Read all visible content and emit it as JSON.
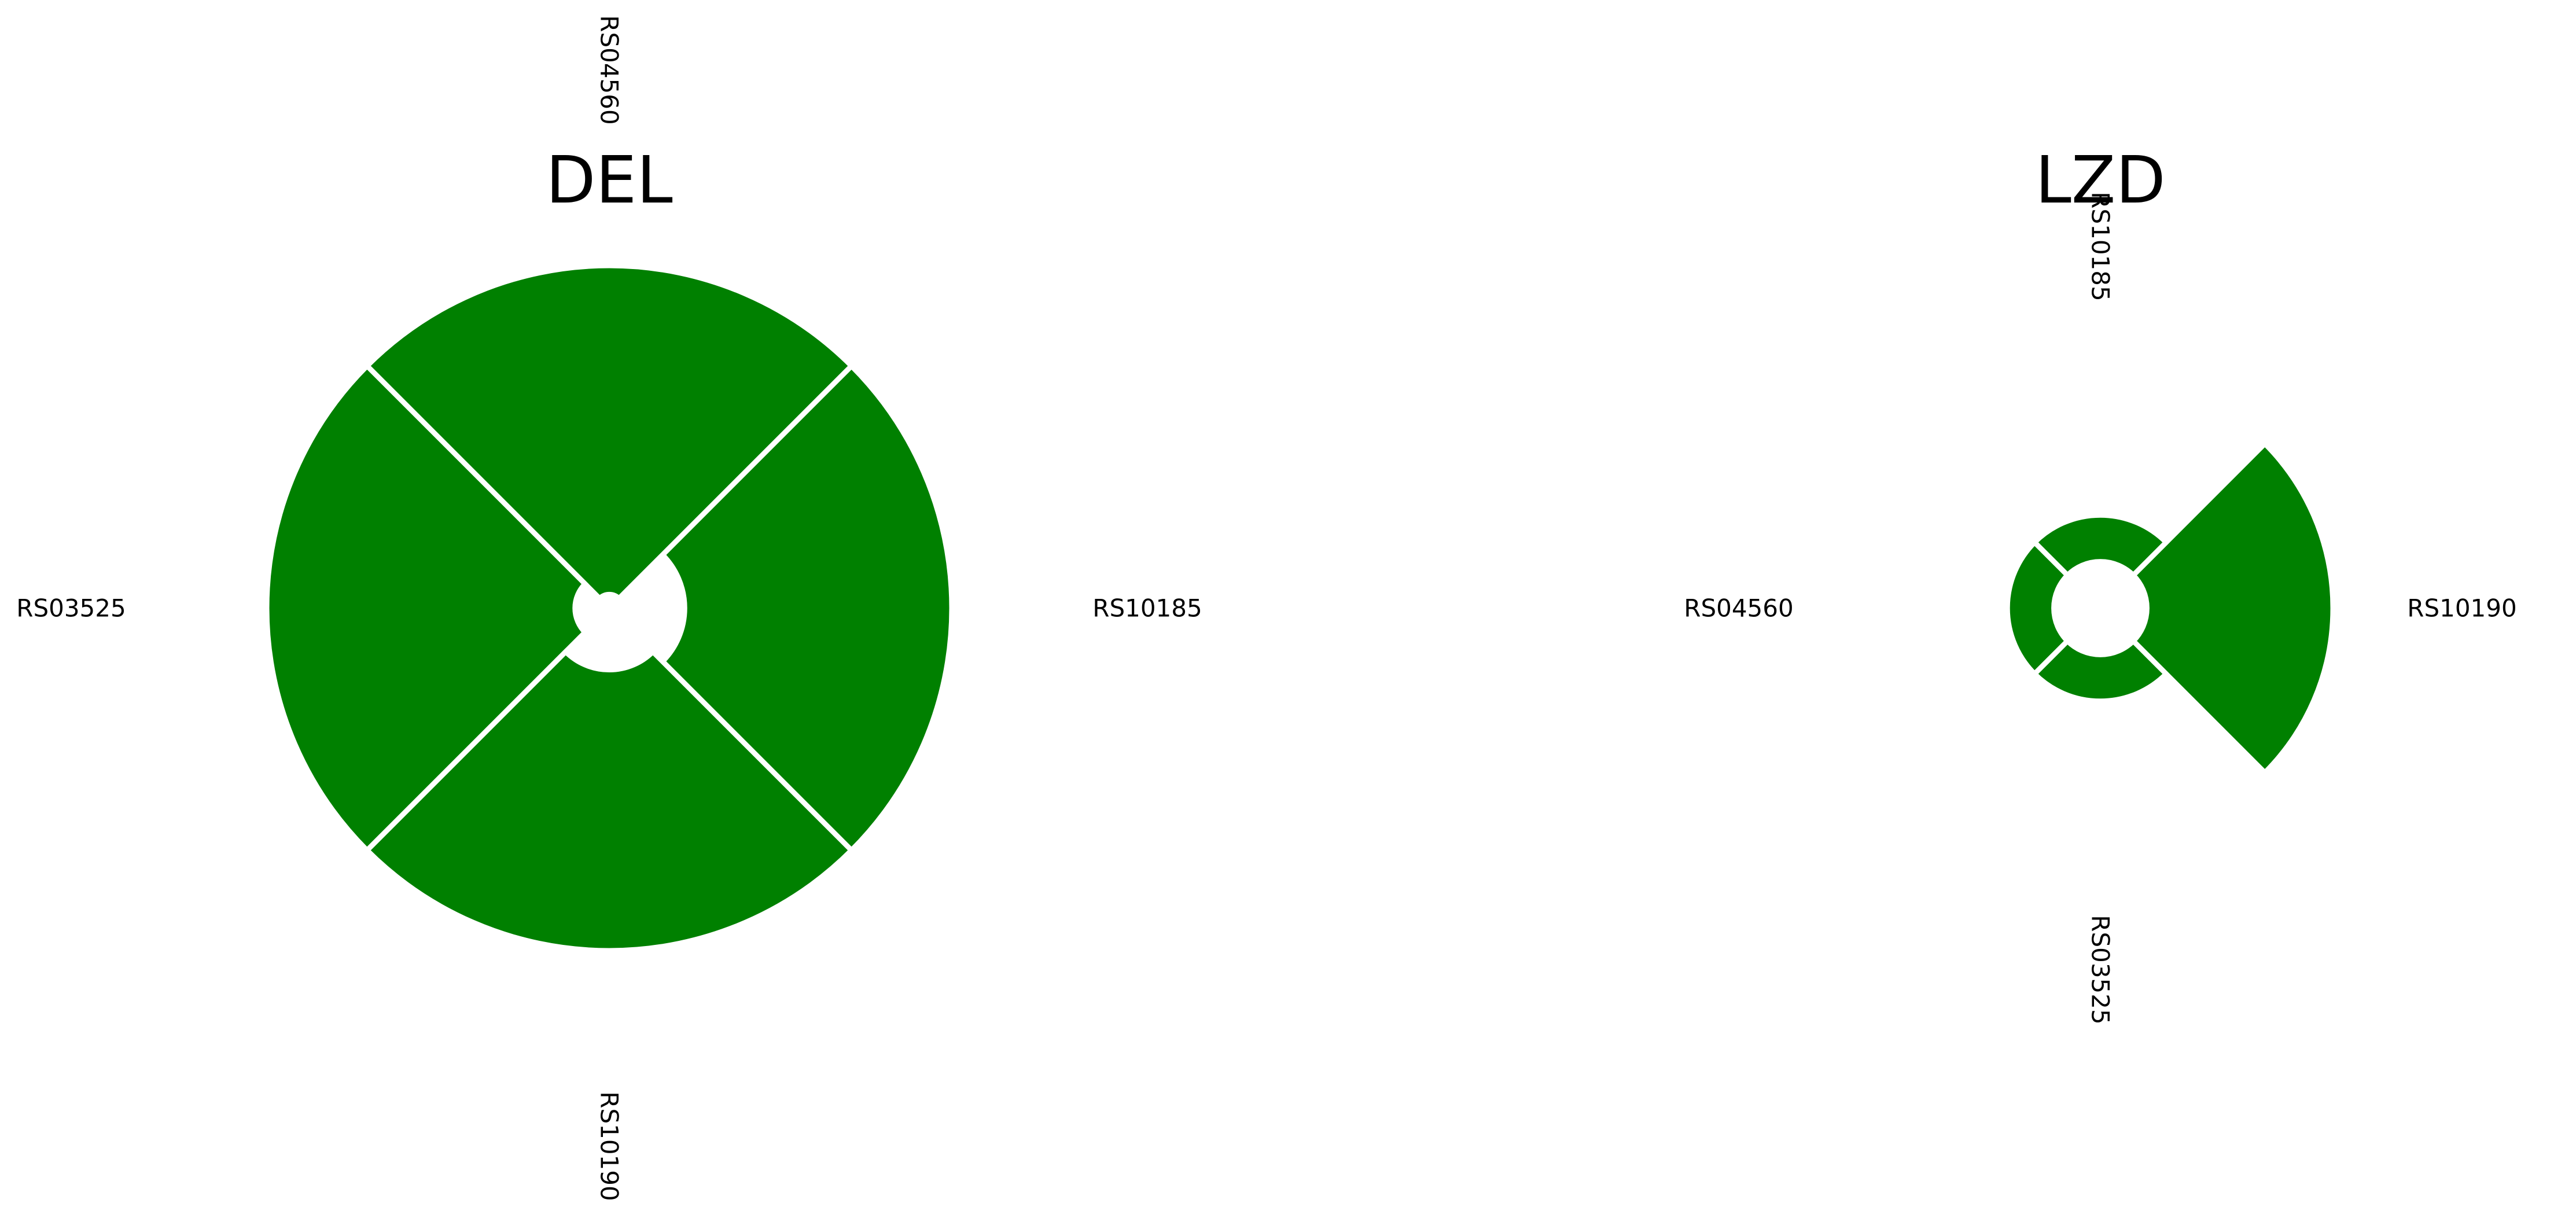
{
  "chart_data": [
    {
      "type": "radial-bar",
      "title": "DEL",
      "color": "#008000",
      "categories": [
        "RS10185",
        "RS04560",
        "RS03525",
        "RS10190"
      ],
      "values": [
        1.0,
        1.0,
        1.0,
        1.0
      ],
      "inner_values": [
        0.22,
        0.04,
        0.1,
        0.18
      ]
    },
    {
      "type": "radial-bar",
      "title": "LZD",
      "color": "#008000",
      "categories": [
        "RS10190",
        "RS10185",
        "RS04560",
        "RS03525"
      ],
      "values": [
        1.0,
        0.4,
        0.4,
        0.4
      ],
      "inner_values": [
        0.2,
        0.2,
        0.2,
        0.2
      ]
    }
  ]
}
